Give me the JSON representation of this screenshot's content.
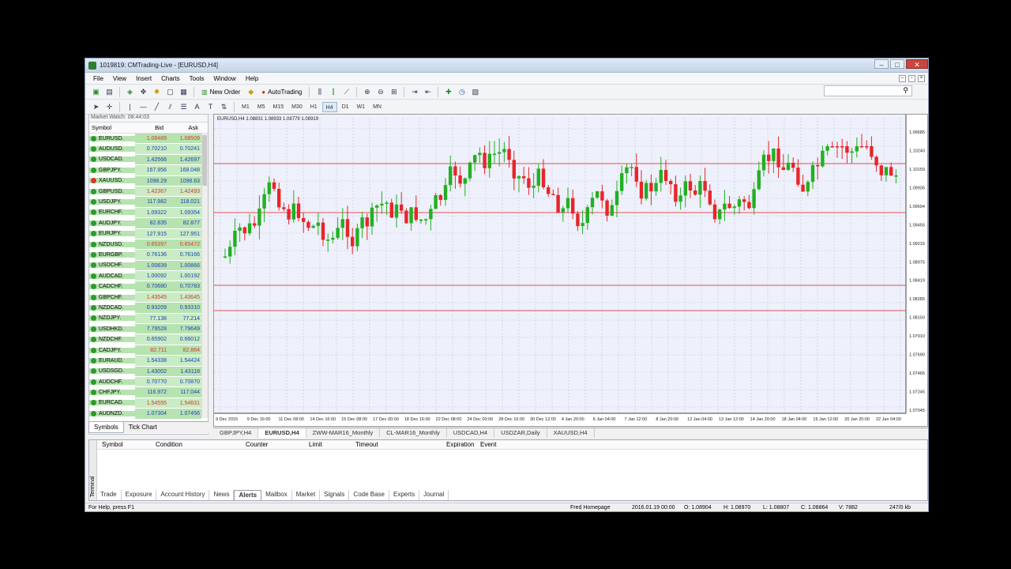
{
  "window": {
    "title": "1019819: CMTrading-Live - [EURUSD,H4]"
  },
  "menu": [
    "File",
    "View",
    "Insert",
    "Charts",
    "Tools",
    "Window",
    "Help"
  ],
  "toolbar": {
    "new_order": "New Order",
    "auto_trading": "AutoTrading",
    "timeframes": [
      "M1",
      "M5",
      "M15",
      "M30",
      "H1",
      "H4",
      "D1",
      "W1",
      "MN"
    ],
    "active_timeframe": "H4"
  },
  "market_watch": {
    "title": "Market Watch: 08:44:03",
    "headers": {
      "symbol": "Symbol",
      "bid": "Bid",
      "ask": "Ask"
    },
    "rows": [
      {
        "symbol": "EURUSD.",
        "bid": "1.08489",
        "ask": "1.08509",
        "dir": "up"
      },
      {
        "symbol": "AUDUSD.",
        "bid": "0.70210",
        "ask": "0.70241",
        "dir": "up"
      },
      {
        "symbol": "USDCAD.",
        "bid": "1.42566",
        "ask": "1.42697",
        "dir": "up"
      },
      {
        "symbol": "GBPJPY.",
        "bid": "167.956",
        "ask": "168.048",
        "dir": "up"
      },
      {
        "symbol": "XAUUSD.",
        "bid": "1098.29",
        "ask": "1098.63",
        "dir": "down"
      },
      {
        "symbol": "GBPUSD.",
        "bid": "1.42367",
        "ask": "1.42493",
        "dir": "up"
      },
      {
        "symbol": "USDJPY.",
        "bid": "117.982",
        "ask": "118.021",
        "dir": "up"
      },
      {
        "symbol": "EURCHF.",
        "bid": "1.09322",
        "ask": "1.09354",
        "dir": "up"
      },
      {
        "symbol": "AUDJPY.",
        "bid": "82.835",
        "ask": "82.877",
        "dir": "up"
      },
      {
        "symbol": "EURJPY.",
        "bid": "127.915",
        "ask": "127.951",
        "dir": "up"
      },
      {
        "symbol": "NZDUSD.",
        "bid": "0.65397",
        "ask": "0.65472",
        "dir": "up"
      },
      {
        "symbol": "EURGBP.",
        "bid": "0.76136",
        "ask": "0.76166",
        "dir": "up"
      },
      {
        "symbol": "USDCHF.",
        "bid": "1.00839",
        "ask": "1.00866",
        "dir": "up"
      },
      {
        "symbol": "AUDCAD.",
        "bid": "1.00092",
        "ask": "1.00192",
        "dir": "up"
      },
      {
        "symbol": "CADCHF.",
        "bid": "0.70680",
        "ask": "0.70783",
        "dir": "up"
      },
      {
        "symbol": "GBPCHF.",
        "bid": "1.43545",
        "ask": "1.43645",
        "dir": "up"
      },
      {
        "symbol": "NZDCAD.",
        "bid": "0.93209",
        "ask": "0.93310",
        "dir": "up"
      },
      {
        "symbol": "NZDJPY.",
        "bid": "77.138",
        "ask": "77.214",
        "dir": "up"
      },
      {
        "symbol": "USDHKD.",
        "bid": "7.79528",
        "ask": "7.79649",
        "dir": "up"
      },
      {
        "symbol": "NZDCHF.",
        "bid": "0.65902",
        "ask": "0.66012",
        "dir": "up"
      },
      {
        "symbol": "CADJPY.",
        "bid": "82.711",
        "ask": "82.864",
        "dir": "up"
      },
      {
        "symbol": "EURAUD.",
        "bid": "1.54338",
        "ask": "1.54424",
        "dir": "up"
      },
      {
        "symbol": "USDSGD.",
        "bid": "1.43002",
        "ask": "1.43118",
        "dir": "up"
      },
      {
        "symbol": "AUDCHF.",
        "bid": "0.70770",
        "ask": "0.70870",
        "dir": "up"
      },
      {
        "symbol": "CHFJPY.",
        "bid": "116.972",
        "ask": "117.044",
        "dir": "up"
      },
      {
        "symbol": "EURCAD.",
        "bid": "1.54555",
        "ask": "1.54631",
        "dir": "up"
      },
      {
        "symbol": "AUDNZD.",
        "bid": "1.07304",
        "ask": "1.07456",
        "dir": "up"
      }
    ],
    "tabs": [
      "Symbols",
      "Tick Chart"
    ]
  },
  "chart": {
    "header": "EURUSD,H4  1.08831 1.08933 1.08779 1.08919",
    "price_labels": [
      "1.09685",
      "1.10240",
      "1.10159",
      "1.09935",
      "1.09694",
      "1.09455",
      "1.09215",
      "1.08975",
      "1.08419",
      "1.08285",
      "1.08150",
      "1.07910",
      "1.07690",
      "1.07465",
      "1.07245",
      "1.07045"
    ],
    "date_labels": [
      "9 Dec 2015",
      "9 Dec 16:00",
      "11 Dec 08:00",
      "14 Dec 16:00",
      "15 Dec 08:00",
      "17 Dec 00:00",
      "18 Dec 16:00",
      "22 Dec 08:00",
      "24 Dec 00:00",
      "28 Dec 16:00",
      "30 Dec 12:00",
      "4 Jan 20:00",
      "6 Jan 04:00",
      "7 Jan 12:00",
      "8 Jan 20:00",
      "12 Jan 04:00",
      "13 Jan 12:00",
      "14 Jan 20:00",
      "18 Jan 04:00",
      "19 Jan 12:00",
      "20 Jan 20:00",
      "22 Jan 04:00"
    ]
  },
  "chart_tabs": [
    "GBPJPY,H4",
    "EURUSD,H4",
    "ZWW-MAR16_Monthly",
    "CL-MAR16_Monthly",
    "USDCAD,H4",
    "USDZAR,Daily",
    "XAUUSD,H4"
  ],
  "active_chart_tab": "EURUSD,H4",
  "terminal": {
    "side_label": "Terminal",
    "columns": [
      "Symbol",
      "Condition",
      "Counter",
      "Limit",
      "Timeout",
      "Expiration",
      "Event"
    ],
    "tabs": [
      "Trade",
      "Exposure",
      "Account History",
      "News",
      "Alerts",
      "Mailbox",
      "Market",
      "Signals",
      "Code Base",
      "Experts",
      "Journal"
    ],
    "active_tab": "Alerts"
  },
  "status": {
    "help": "For Help, press F1",
    "profile": "Fred Homepage",
    "datetime": "2016.01.19 00:00",
    "open": "O: 1.08904",
    "high": "H: 1.08970",
    "low": "L: 1.08807",
    "close": "C: 1.08864",
    "volume": "V: 7882",
    "traffic": "247/0 kb"
  }
}
